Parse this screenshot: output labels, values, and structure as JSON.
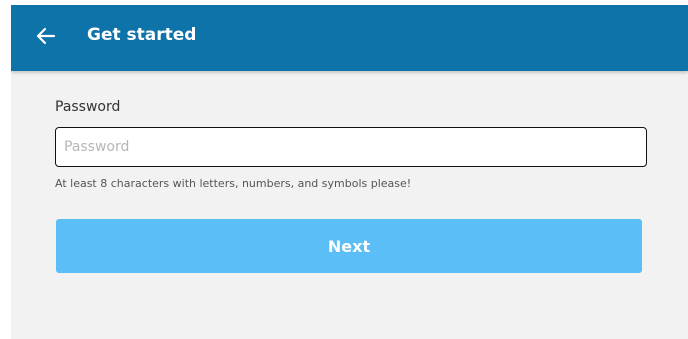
{
  "header": {
    "back_icon": "arrow-left-icon",
    "title": "Get started"
  },
  "form": {
    "password_label": "Password",
    "password_placeholder": "Password",
    "password_value": "",
    "hint": "At least 8 characters with letters, numbers, and symbols please!",
    "next_label": "Next"
  },
  "colors": {
    "header_bg": "#0d73a8",
    "page_bg": "#f2f2f2",
    "button_bg": "#5bbef7"
  }
}
